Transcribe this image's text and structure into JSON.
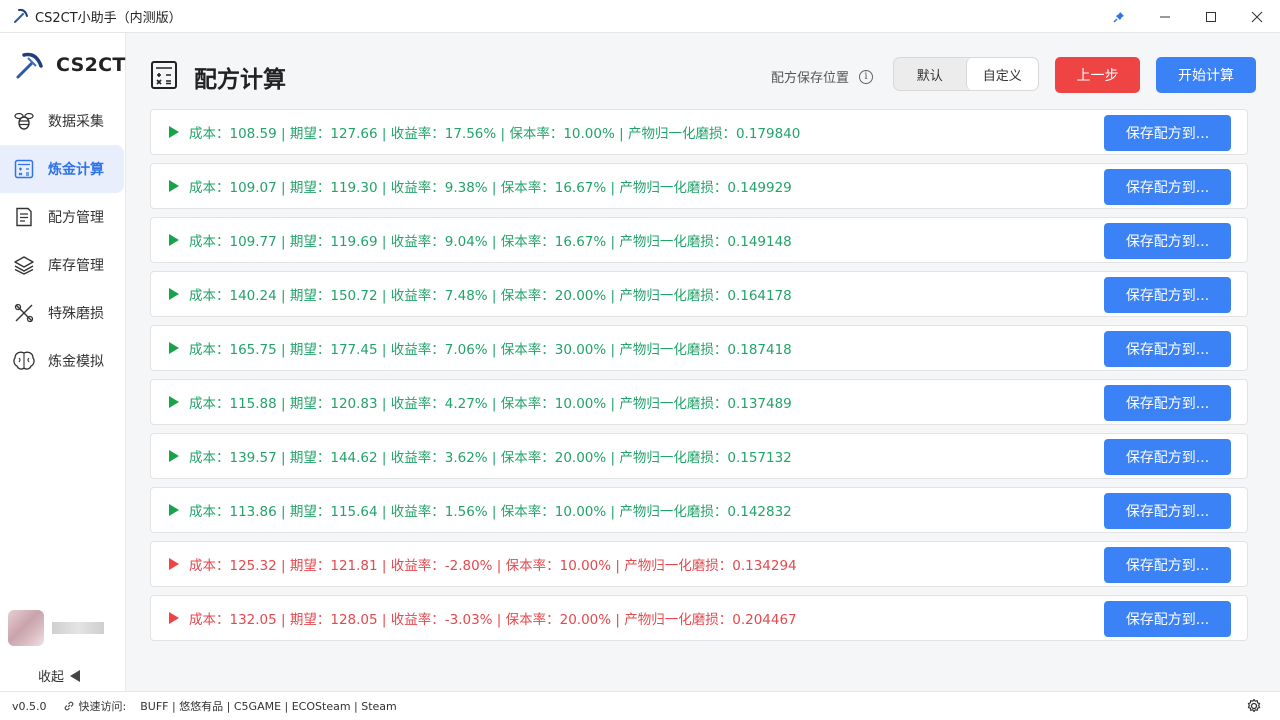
{
  "window": {
    "title": "CS2CT小助手（内测版）"
  },
  "sidebar": {
    "brand": "CS2CT",
    "items": [
      {
        "label": "数据采集",
        "icon": "bee-icon"
      },
      {
        "label": "炼金计算",
        "icon": "calculator-icon",
        "active": true
      },
      {
        "label": "配方管理",
        "icon": "document-icon"
      },
      {
        "label": "库存管理",
        "icon": "layers-icon"
      },
      {
        "label": "特殊磨损",
        "icon": "tools-icon"
      },
      {
        "label": "炼金模拟",
        "icon": "brain-icon"
      }
    ],
    "collapse": "收起"
  },
  "page": {
    "title": "配方计算",
    "save_location_label": "配方保存位置",
    "info_glyph": "i",
    "segment": {
      "default": "默认",
      "custom": "自定义",
      "selected": "custom"
    },
    "back_button": "上一步",
    "start_button": "开始计算"
  },
  "results": [
    {
      "text": "成本：108.59 | 期望：127.66 | 收益率：17.56% | 保本率：10.00% | 产物归一化磨损：0.179840",
      "positive": true,
      "button": "保存配方到..."
    },
    {
      "text": "成本：109.07 | 期望：119.30 | 收益率：9.38% | 保本率：16.67% | 产物归一化磨损：0.149929",
      "positive": true,
      "button": "保存配方到..."
    },
    {
      "text": "成本：109.77 | 期望：119.69 | 收益率：9.04% | 保本率：16.67% | 产物归一化磨损：0.149148",
      "positive": true,
      "button": "保存配方到..."
    },
    {
      "text": "成本：140.24 | 期望：150.72 | 收益率：7.48% | 保本率：20.00% | 产物归一化磨损：0.164178",
      "positive": true,
      "button": "保存配方到..."
    },
    {
      "text": "成本：165.75 | 期望：177.45 | 收益率：7.06% | 保本率：30.00% | 产物归一化磨损：0.187418",
      "positive": true,
      "button": "保存配方到..."
    },
    {
      "text": "成本：115.88 | 期望：120.83 | 收益率：4.27% | 保本率：10.00% | 产物归一化磨损：0.137489",
      "positive": true,
      "button": "保存配方到..."
    },
    {
      "text": "成本：139.57 | 期望：144.62 | 收益率：3.62% | 保本率：20.00% | 产物归一化磨损：0.157132",
      "positive": true,
      "button": "保存配方到..."
    },
    {
      "text": "成本：113.86 | 期望：115.64 | 收益率：1.56% | 保本率：10.00% | 产物归一化磨损：0.142832",
      "positive": true,
      "button": "保存配方到..."
    },
    {
      "text": "成本：125.32 | 期望：121.81 | 收益率：-2.80% | 保本率：10.00% | 产物归一化磨损：0.134294",
      "positive": false,
      "button": "保存配方到..."
    },
    {
      "text": "成本：132.05 | 期望：128.05 | 收益率：-3.03% | 保本率：20.00% | 产物归一化磨损：0.204467",
      "positive": false,
      "button": "保存配方到..."
    }
  ],
  "statusbar": {
    "version": "v0.5.0",
    "quick_access": "快速访问:",
    "links": "BUFF | 悠悠有品 | C5GAME | ECOSteam | Steam"
  },
  "colors": {
    "accent": "#3b82f6",
    "danger": "#ef4444",
    "positive_text": "#22a36a",
    "negative_text": "#e5484d",
    "active_nav_bg": "#e8eefb"
  }
}
